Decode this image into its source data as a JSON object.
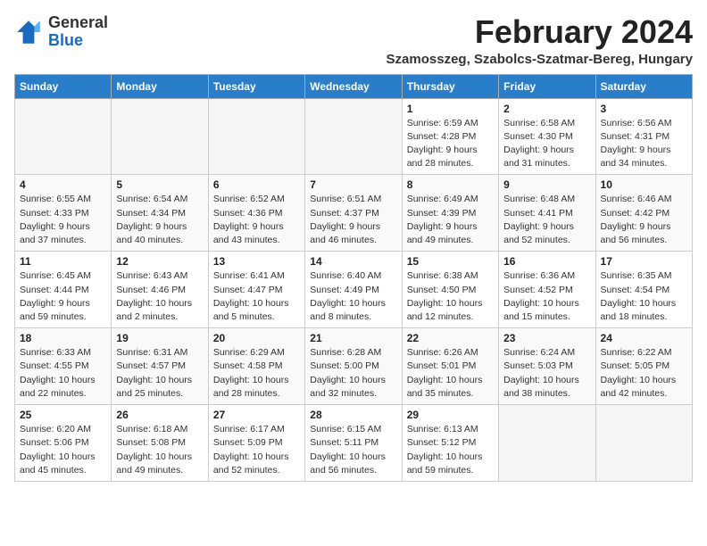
{
  "header": {
    "logo_general": "General",
    "logo_blue": "Blue",
    "title": "February 2024",
    "location": "Szamosszeg, Szabolcs-Szatmar-Bereg, Hungary"
  },
  "weekdays": [
    "Sunday",
    "Monday",
    "Tuesday",
    "Wednesday",
    "Thursday",
    "Friday",
    "Saturday"
  ],
  "weeks": [
    [
      {
        "day": "",
        "info": ""
      },
      {
        "day": "",
        "info": ""
      },
      {
        "day": "",
        "info": ""
      },
      {
        "day": "",
        "info": ""
      },
      {
        "day": "1",
        "info": "Sunrise: 6:59 AM\nSunset: 4:28 PM\nDaylight: 9 hours\nand 28 minutes."
      },
      {
        "day": "2",
        "info": "Sunrise: 6:58 AM\nSunset: 4:30 PM\nDaylight: 9 hours\nand 31 minutes."
      },
      {
        "day": "3",
        "info": "Sunrise: 6:56 AM\nSunset: 4:31 PM\nDaylight: 9 hours\nand 34 minutes."
      }
    ],
    [
      {
        "day": "4",
        "info": "Sunrise: 6:55 AM\nSunset: 4:33 PM\nDaylight: 9 hours\nand 37 minutes."
      },
      {
        "day": "5",
        "info": "Sunrise: 6:54 AM\nSunset: 4:34 PM\nDaylight: 9 hours\nand 40 minutes."
      },
      {
        "day": "6",
        "info": "Sunrise: 6:52 AM\nSunset: 4:36 PM\nDaylight: 9 hours\nand 43 minutes."
      },
      {
        "day": "7",
        "info": "Sunrise: 6:51 AM\nSunset: 4:37 PM\nDaylight: 9 hours\nand 46 minutes."
      },
      {
        "day": "8",
        "info": "Sunrise: 6:49 AM\nSunset: 4:39 PM\nDaylight: 9 hours\nand 49 minutes."
      },
      {
        "day": "9",
        "info": "Sunrise: 6:48 AM\nSunset: 4:41 PM\nDaylight: 9 hours\nand 52 minutes."
      },
      {
        "day": "10",
        "info": "Sunrise: 6:46 AM\nSunset: 4:42 PM\nDaylight: 9 hours\nand 56 minutes."
      }
    ],
    [
      {
        "day": "11",
        "info": "Sunrise: 6:45 AM\nSunset: 4:44 PM\nDaylight: 9 hours\nand 59 minutes."
      },
      {
        "day": "12",
        "info": "Sunrise: 6:43 AM\nSunset: 4:46 PM\nDaylight: 10 hours\nand 2 minutes."
      },
      {
        "day": "13",
        "info": "Sunrise: 6:41 AM\nSunset: 4:47 PM\nDaylight: 10 hours\nand 5 minutes."
      },
      {
        "day": "14",
        "info": "Sunrise: 6:40 AM\nSunset: 4:49 PM\nDaylight: 10 hours\nand 8 minutes."
      },
      {
        "day": "15",
        "info": "Sunrise: 6:38 AM\nSunset: 4:50 PM\nDaylight: 10 hours\nand 12 minutes."
      },
      {
        "day": "16",
        "info": "Sunrise: 6:36 AM\nSunset: 4:52 PM\nDaylight: 10 hours\nand 15 minutes."
      },
      {
        "day": "17",
        "info": "Sunrise: 6:35 AM\nSunset: 4:54 PM\nDaylight: 10 hours\nand 18 minutes."
      }
    ],
    [
      {
        "day": "18",
        "info": "Sunrise: 6:33 AM\nSunset: 4:55 PM\nDaylight: 10 hours\nand 22 minutes."
      },
      {
        "day": "19",
        "info": "Sunrise: 6:31 AM\nSunset: 4:57 PM\nDaylight: 10 hours\nand 25 minutes."
      },
      {
        "day": "20",
        "info": "Sunrise: 6:29 AM\nSunset: 4:58 PM\nDaylight: 10 hours\nand 28 minutes."
      },
      {
        "day": "21",
        "info": "Sunrise: 6:28 AM\nSunset: 5:00 PM\nDaylight: 10 hours\nand 32 minutes."
      },
      {
        "day": "22",
        "info": "Sunrise: 6:26 AM\nSunset: 5:01 PM\nDaylight: 10 hours\nand 35 minutes."
      },
      {
        "day": "23",
        "info": "Sunrise: 6:24 AM\nSunset: 5:03 PM\nDaylight: 10 hours\nand 38 minutes."
      },
      {
        "day": "24",
        "info": "Sunrise: 6:22 AM\nSunset: 5:05 PM\nDaylight: 10 hours\nand 42 minutes."
      }
    ],
    [
      {
        "day": "25",
        "info": "Sunrise: 6:20 AM\nSunset: 5:06 PM\nDaylight: 10 hours\nand 45 minutes."
      },
      {
        "day": "26",
        "info": "Sunrise: 6:18 AM\nSunset: 5:08 PM\nDaylight: 10 hours\nand 49 minutes."
      },
      {
        "day": "27",
        "info": "Sunrise: 6:17 AM\nSunset: 5:09 PM\nDaylight: 10 hours\nand 52 minutes."
      },
      {
        "day": "28",
        "info": "Sunrise: 6:15 AM\nSunset: 5:11 PM\nDaylight: 10 hours\nand 56 minutes."
      },
      {
        "day": "29",
        "info": "Sunrise: 6:13 AM\nSunset: 5:12 PM\nDaylight: 10 hours\nand 59 minutes."
      },
      {
        "day": "",
        "info": ""
      },
      {
        "day": "",
        "info": ""
      }
    ]
  ]
}
